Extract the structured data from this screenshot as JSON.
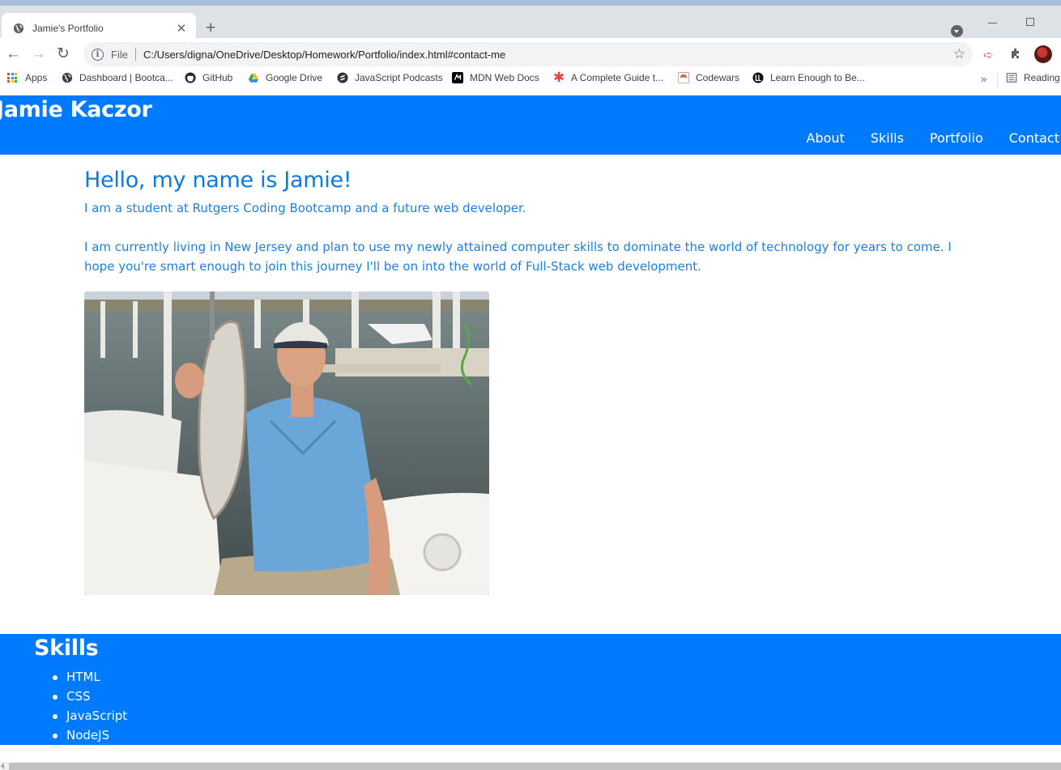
{
  "browser": {
    "tab_title": "Jamie's Portfolio",
    "url_scheme": "File",
    "url": "C:/Users/digna/OneDrive/Desktop/Homework/Portfolio/index.html#contact-me",
    "bookmarks": [
      {
        "label": "Apps",
        "icon": "apps-grid-icon"
      },
      {
        "label": "Dashboard | Bootca...",
        "icon": "globe-icon"
      },
      {
        "label": "GitHub",
        "icon": "github-icon"
      },
      {
        "label": "Google Drive",
        "icon": "google-drive-icon"
      },
      {
        "label": "JavaScript Podcasts",
        "icon": "podcast-icon"
      },
      {
        "label": "MDN Web Docs",
        "icon": "mdn-icon"
      },
      {
        "label": "A Complete Guide t...",
        "icon": "asterisk-icon"
      },
      {
        "label": "Codewars",
        "icon": "codewars-icon"
      },
      {
        "label": "Learn Enough to Be...",
        "icon": "learn-enough-icon"
      }
    ],
    "reading_list": "Reading"
  },
  "header": {
    "name": "Jamie Kaczor",
    "nav": [
      "About",
      "Skills",
      "Portfolio",
      "Contact"
    ]
  },
  "about": {
    "heading": "Hello, my name is Jamie!",
    "para1": "I am a student at Rutgers Coding Bootcamp and a future web developer.",
    "para2": "I am currently living in New Jersey and plan to use my newly attained computer skills to dominate the world of technology for years to come. I hope you're smart enough to join this journey I'll be on into the world of Full-Stack web development."
  },
  "skills": {
    "heading": "Skills",
    "items": [
      "HTML",
      "CSS",
      "JavaScript",
      "NodeJS"
    ]
  },
  "colors": {
    "brand": "#007bff",
    "text_blue": "#1c80e6"
  }
}
